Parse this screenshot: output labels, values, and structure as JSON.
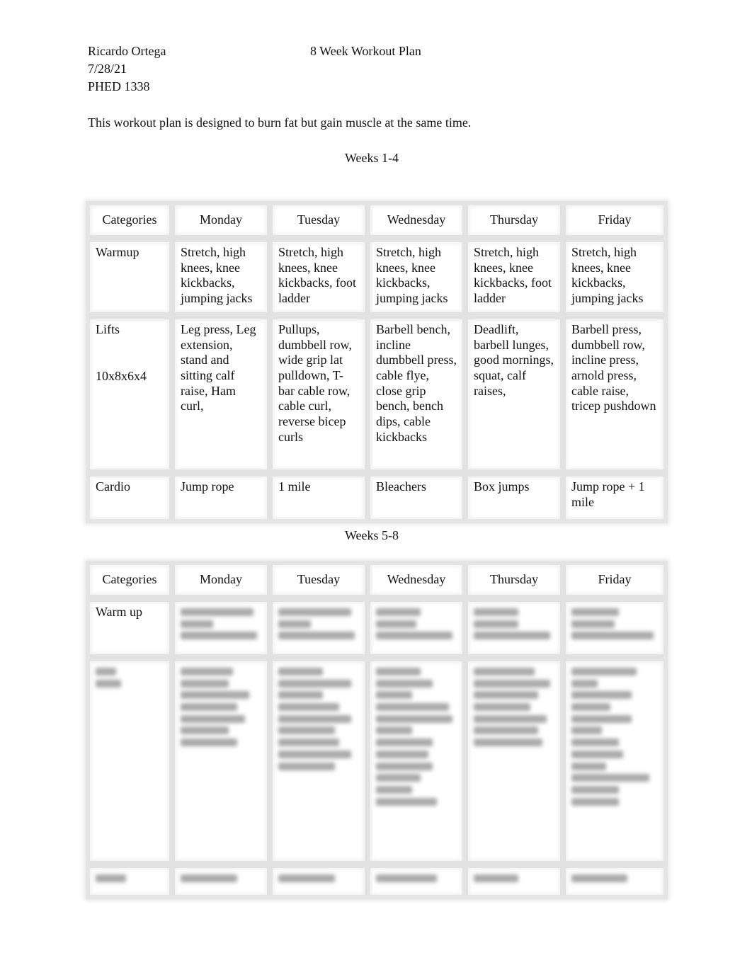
{
  "header": {
    "author": "Ricardo Ortega",
    "date": "7/28/21",
    "course": "PHED 1338",
    "title": "8 Week Workout Plan"
  },
  "intro": "This workout plan is designed to burn fat but gain muscle at the same time.",
  "table1": {
    "heading": "Weeks 1-4",
    "columns": [
      "Categories",
      "Monday",
      "Tuesday",
      "Wednesday",
      "Thursday",
      "Friday"
    ],
    "rows": [
      {
        "category": "Warmup",
        "category_note": "",
        "cells": [
          "Stretch, high knees, knee kickbacks, jumping jacks",
          "Stretch, high knees, knee kickbacks, foot ladder",
          "Stretch, high knees, knee kickbacks, jumping jacks",
          "Stretch, high knees, knee kickbacks, foot ladder",
          "Stretch, high knees, knee kickbacks, jumping jacks"
        ]
      },
      {
        "category": "Lifts",
        "category_note": "10x8x6x4",
        "cells": [
          "Leg press, Leg extension, stand and sitting calf raise, Ham curl,",
          "Pullups, dumbbell row, wide grip lat pulldown, T-bar cable row, cable curl, reverse bicep curls",
          "Barbell bench, incline dumbbell press, cable flye, close grip bench, bench dips, cable kickbacks",
          "Deadlift, barbell lunges, good mornings, squat, calf raises,",
          "Barbell press, dumbbell row, incline press, arnold press, cable raise, tricep pushdown"
        ]
      },
      {
        "category": "Cardio",
        "category_note": "",
        "cells": [
          "Jump rope",
          "1 mile",
          "Bleachers",
          "Box jumps",
          "Jump rope + 1 mile"
        ]
      }
    ]
  },
  "table2": {
    "heading": "Weeks 5-8",
    "columns": [
      "Categories",
      "Monday",
      "Tuesday",
      "Wednesday",
      "Thursday",
      "Friday"
    ],
    "rows": [
      {
        "category": "Warm up",
        "category_redacted": false
      },
      {
        "category": "",
        "category_redacted": true
      },
      {
        "category": "",
        "category_redacted": true
      }
    ],
    "redacted_note": "Cell contents blurred/obscured in source"
  }
}
